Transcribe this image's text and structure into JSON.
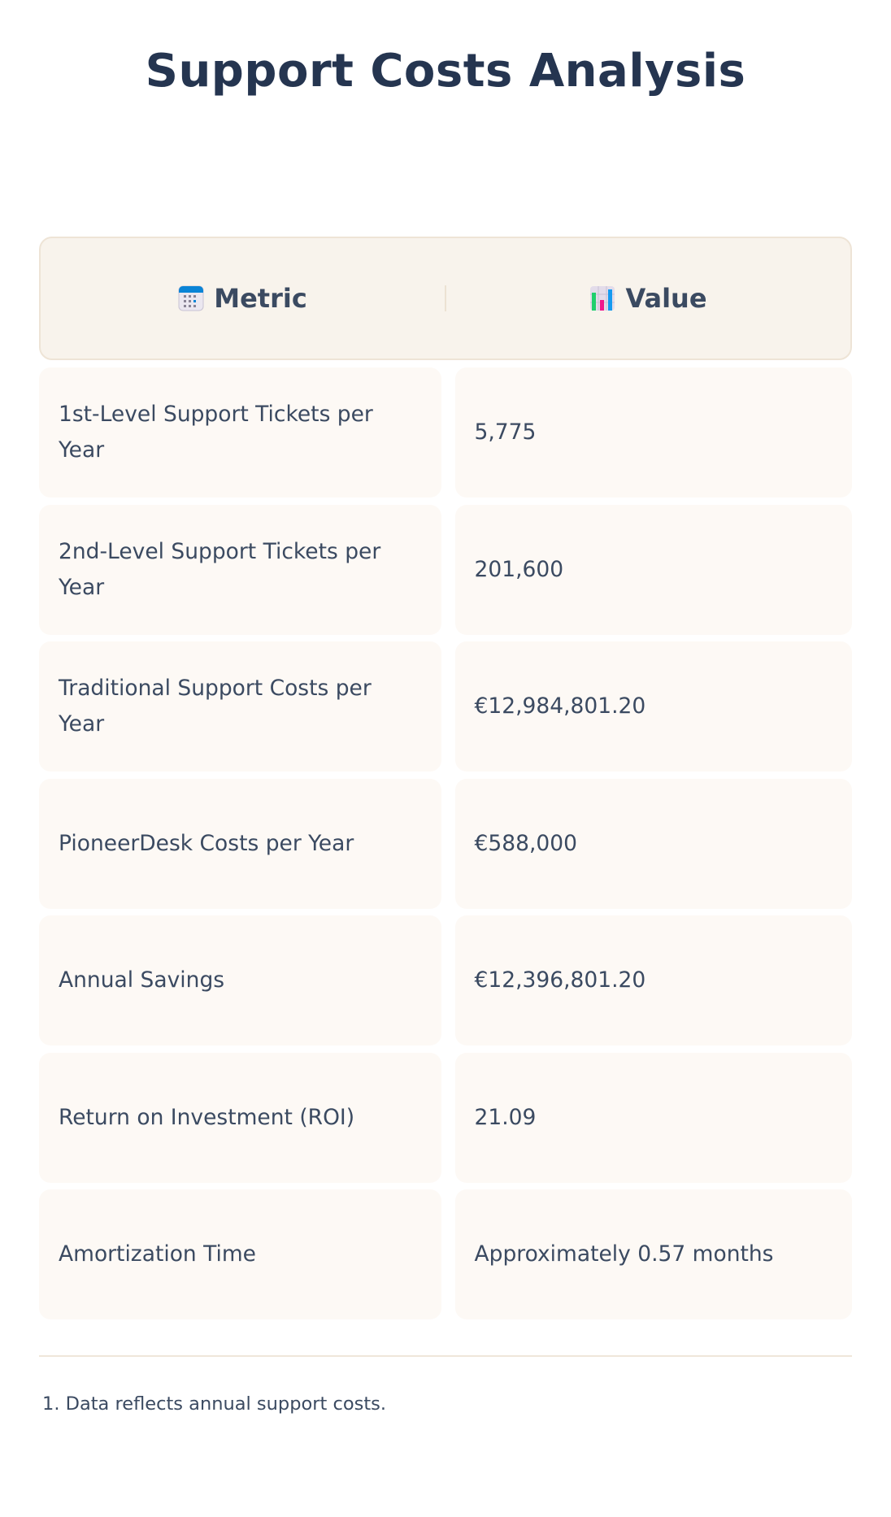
{
  "page": {
    "title": "Support Costs Analysis"
  },
  "table": {
    "headers": [
      {
        "icon": "calendar-icon",
        "label": "Metric"
      },
      {
        "icon": "bar-chart-icon",
        "label": "Value"
      }
    ],
    "rows": [
      {
        "metric": "1st-Level Support Tickets per Year",
        "value": "5,775"
      },
      {
        "metric": "2nd-Level Support Tickets per Year",
        "value": "201,600"
      },
      {
        "metric": "Traditional Support Costs per Year",
        "value": "€12,984,801.20"
      },
      {
        "metric": "PioneerDesk Costs per Year",
        "value": "€588,000"
      },
      {
        "metric": "Annual Savings",
        "value": "€12,396,801.20"
      },
      {
        "metric": "Return on Investment (ROI)",
        "value": "21.09"
      },
      {
        "metric": "Amortization Time",
        "value": "Approximately 0.57 months"
      }
    ]
  },
  "footnotes": [
    "1. Data reflects annual support costs."
  ],
  "colors": {
    "title": "#253550",
    "text": "#3b4a61",
    "header_bg": "#f8f3ec",
    "header_border": "#eee4d6",
    "cell_bg": "#fdf9f5",
    "divider": "#efe6da"
  }
}
